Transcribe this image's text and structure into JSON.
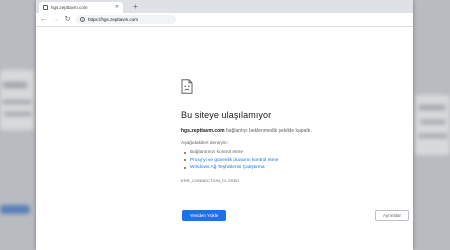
{
  "browser": {
    "tab_title": "hgs.zepttavm.com",
    "tab_close": "✕",
    "new_tab": "+",
    "url": "https://hgs.zepttavm.com",
    "nav": {
      "back": "←",
      "forward": "→",
      "reload": "↻"
    },
    "info_glyph": "i"
  },
  "error": {
    "icon": "sad-page-icon",
    "title": "Bu siteye ulaşılamıyor",
    "host": "hgs.zepttavm.com",
    "description_suffix": " bağlantıyı beklenmedik şekilde kapattı.",
    "try_label": "Aşağıdakileri deneyin:",
    "suggestions": [
      {
        "text": "Bağlantınızı kontrol etme",
        "link": false
      },
      {
        "text": "Proxy'yi ve güvenlik duvarını kontrol etme",
        "link": true
      },
      {
        "text": "Windows Ağ Teşhislerini Çalıştırma",
        "link": true
      }
    ],
    "code": "ERR_CONNECTION_CLOSED"
  },
  "buttons": {
    "reload": "Yeniden Yükle",
    "details": "Ayrıntılar"
  },
  "colors": {
    "accent": "#1a73e8",
    "text_primary": "#202124",
    "text_secondary": "#5f6368"
  }
}
